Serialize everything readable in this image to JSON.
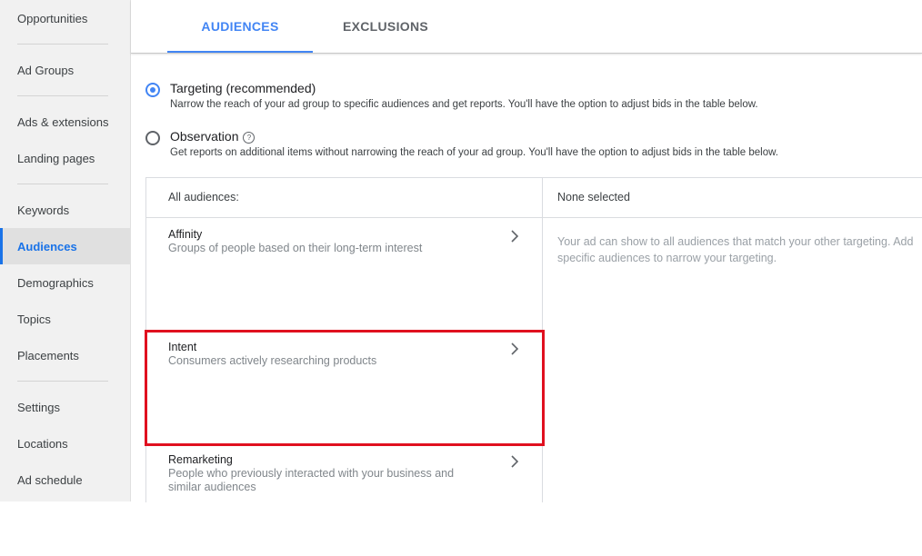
{
  "sidebar": {
    "items": [
      {
        "label": "Opportunities"
      },
      {
        "label": "Ad Groups"
      },
      {
        "label": "Ads & extensions"
      },
      {
        "label": "Landing pages"
      },
      {
        "label": "Keywords"
      },
      {
        "label": "Audiences",
        "active": true
      },
      {
        "label": "Demographics"
      },
      {
        "label": "Topics"
      },
      {
        "label": "Placements"
      },
      {
        "label": "Settings"
      },
      {
        "label": "Locations"
      },
      {
        "label": "Ad schedule"
      }
    ]
  },
  "tabs": [
    {
      "label": "AUDIENCES",
      "active": true
    },
    {
      "label": "EXCLUSIONS"
    }
  ],
  "targeting": {
    "title": "Targeting (recommended)",
    "desc": "Narrow the reach of your ad group to specific audiences and get reports. You'll have the option to adjust bids in the table below.",
    "checked": true
  },
  "observation": {
    "title": "Observation",
    "desc": "Get reports on additional items without narrowing the reach of your ad group. You'll have the option to adjust bids in the table below.",
    "help_icon": "?"
  },
  "panel": {
    "left_header": "All audiences:",
    "right_header": "None selected",
    "empty_note": "Your ad can show to all audiences that match your other targeting. Add specific audiences to narrow your targeting.",
    "items": [
      {
        "title": "Affinity",
        "desc": "Groups of people based on their long-term interest"
      },
      {
        "title": "Intent",
        "desc": "Consumers actively researching products"
      },
      {
        "title": "Remarketing",
        "desc": "People who previously interacted with your business and similar audiences"
      }
    ]
  },
  "colors": {
    "accent": "#4285f4",
    "highlight": "#e0101f"
  }
}
